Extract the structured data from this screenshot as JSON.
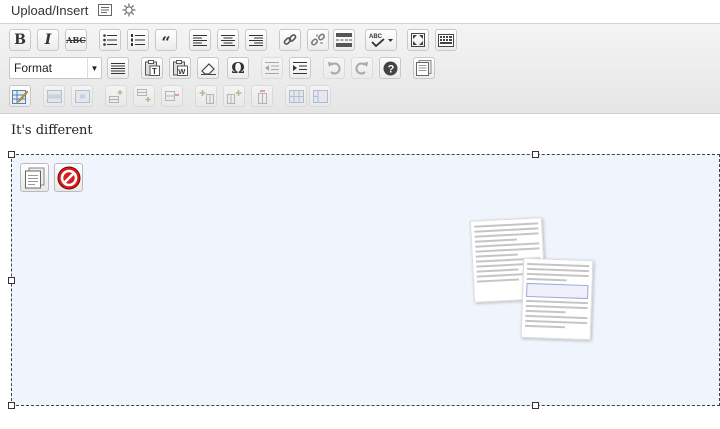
{
  "upload": {
    "label": "Upload/Insert",
    "icons": [
      "media-icon",
      "gallery-icon"
    ]
  },
  "toolbar": {
    "format_label": "Format",
    "special_char_label": "Ω",
    "row1": [
      "bold-button",
      "italic-button",
      "strikethrough-button",
      "bullet-list-button",
      "numbered-list-button",
      "blockquote-button",
      "align-left-button",
      "align-center-button",
      "align-right-button",
      "insert-link-button",
      "unlink-button",
      "more-tag-button",
      "spellcheck-button",
      "fullscreen-button",
      "kitchen-sink-button"
    ],
    "row2": [
      "format-select",
      "justify-button",
      "paste-text-button",
      "paste-word-button",
      "clear-formatting-button",
      "special-character-button",
      "outdent-button",
      "indent-button",
      "undo-button",
      "redo-button",
      "help-button",
      "gallery-button"
    ],
    "row3": [
      "edit-table-button",
      "row-properties-button",
      "cell-properties-button",
      "insert-row-before-button",
      "insert-row-after-button",
      "delete-row-button",
      "insert-column-before-button",
      "insert-column-after-button",
      "delete-column-button",
      "split-cells-button",
      "merge-cells-button"
    ]
  },
  "editor": {
    "text": "It's different"
  },
  "gallery": {
    "buttons": [
      "edit-gallery-button",
      "delete-gallery-button"
    ]
  }
}
